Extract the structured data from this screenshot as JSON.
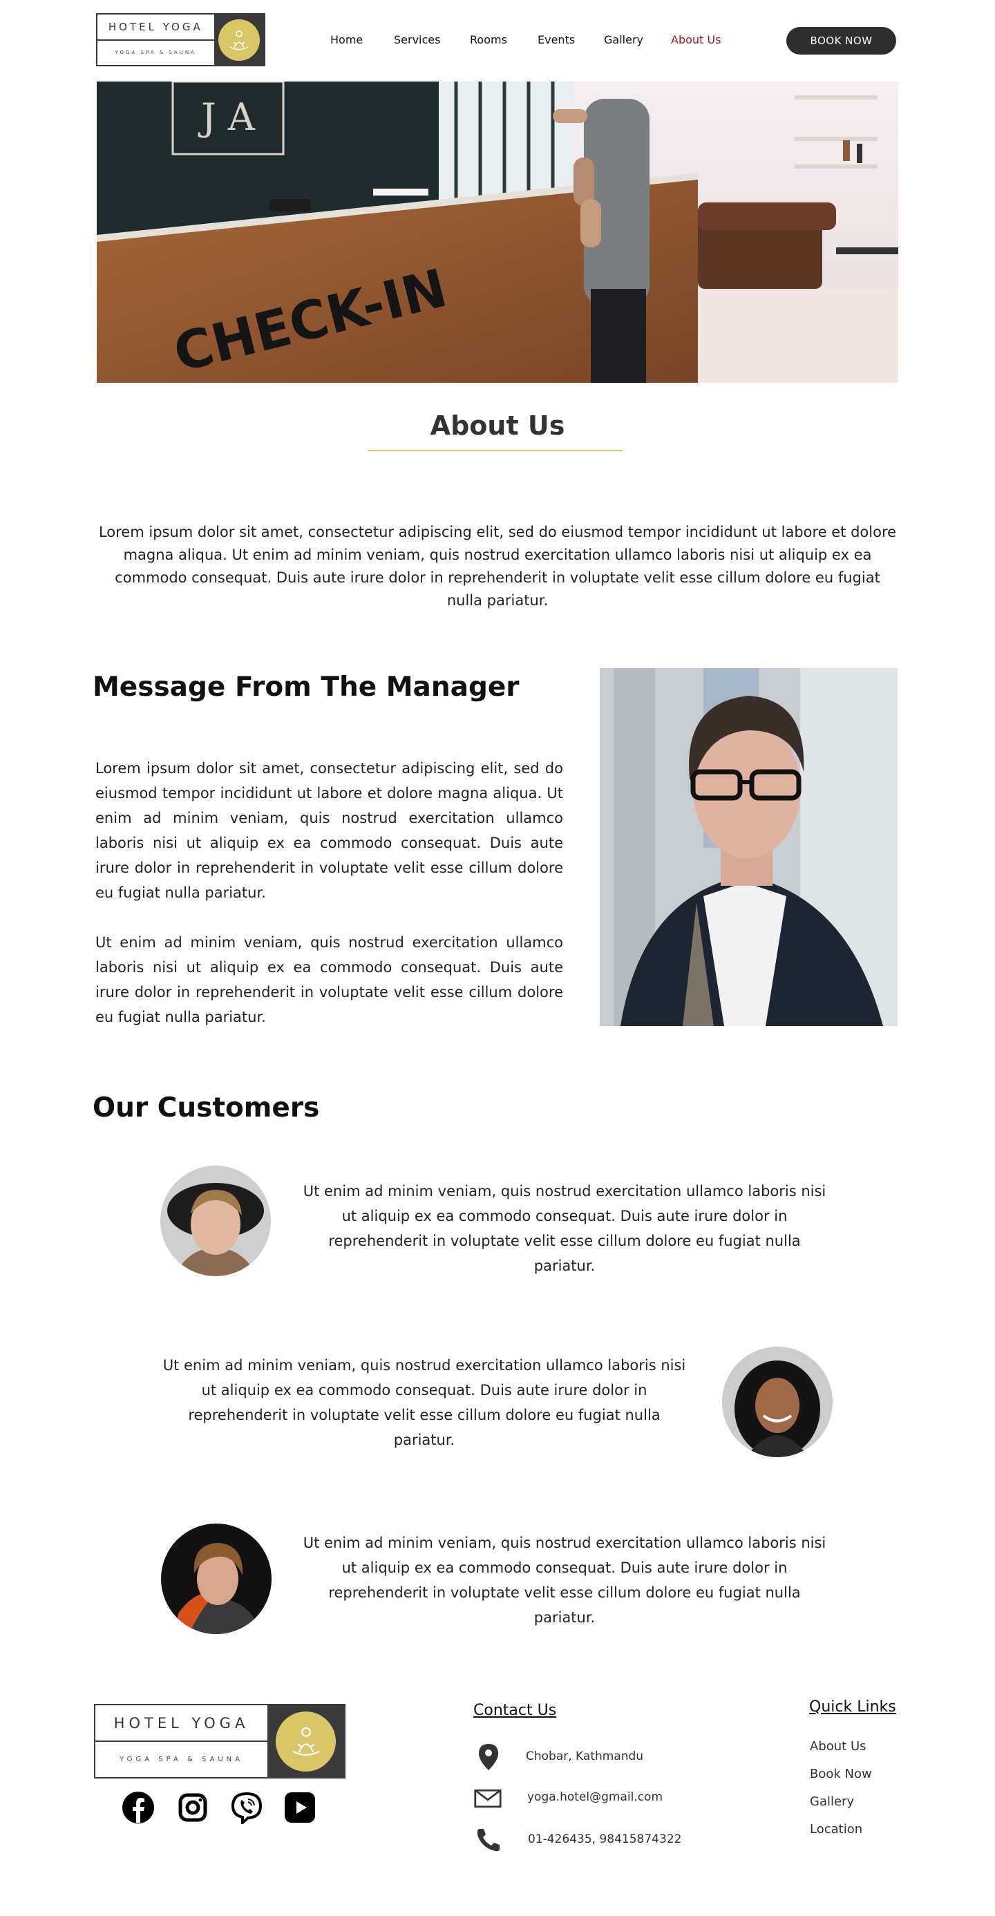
{
  "brand": {
    "name": "HOTEL YOGA",
    "tagline": "YOGA SPA & SAUNA",
    "badge_color": "#d9c667"
  },
  "nav": {
    "items": [
      {
        "label": "Home"
      },
      {
        "label": "Services"
      },
      {
        "label": "Rooms"
      },
      {
        "label": "Events"
      },
      {
        "label": "Gallery"
      },
      {
        "label": "About Us",
        "active": true
      }
    ],
    "active_color": "#a01820",
    "book_label": "BOOK NOW"
  },
  "hero": {
    "sign_letters": "J A",
    "counter_text": "CHECK-IN"
  },
  "about": {
    "title": "About Us",
    "text": "Lorem ipsum dolor sit amet, consectetur adipiscing elit, sed do eiusmod tempor incididunt ut labore et dolore magna aliqua. Ut enim ad minim veniam, quis nostrud exercitation ullamco laboris nisi ut aliquip ex ea commodo consequat. Duis aute irure dolor in reprehenderit in voluptate velit esse cillum dolore eu fugiat nulla pariatur."
  },
  "manager": {
    "title": "Message From The Manager",
    "paragraph_1": "Lorem ipsum dolor sit amet, consectetur adipiscing elit, sed do eiusmod tempor incididunt ut labore et dolore magna aliqua. Ut enim ad minim veniam, quis nostrud exercitation ullamco laboris nisi ut aliquip ex ea commodo consequat. Duis aute irure dolor in reprehenderit in voluptate velit esse cillum dolore eu fugiat nulla pariatur.",
    "paragraph_2": "Ut enim ad minim veniam, quis nostrud exercitation ullamco laboris nisi ut aliquip ex ea commodo consequat. Duis aute irure dolor in reprehenderit in voluptate velit esse cillum dolore eu fugiat nulla pariatur."
  },
  "customers": {
    "title": "Our Customers",
    "items": [
      {
        "text": "Ut enim ad minim veniam, quis nostrud exercitation ullamco laboris nisi ut aliquip ex ea commodo consequat. Duis aute irure dolor in reprehenderit in voluptate velit esse cillum dolore eu fugiat nulla pariatur."
      },
      {
        "text": "Ut enim ad minim veniam, quis nostrud exercitation ullamco laboris nisi ut aliquip ex ea commodo consequat. Duis aute irure dolor in reprehenderit in voluptate velit esse cillum dolore eu fugiat nulla pariatur."
      },
      {
        "text": "Ut enim ad minim veniam, quis nostrud exercitation ullamco laboris nisi ut aliquip ex ea commodo consequat. Duis aute irure dolor in reprehenderit in voluptate velit esse cillum dolore eu fugiat nulla pariatur."
      }
    ]
  },
  "footer": {
    "social": [
      "facebook-icon",
      "instagram-icon",
      "viber-icon",
      "youtube-icon"
    ],
    "contact": {
      "title": "Contact Us",
      "address": "Chobar, Kathmandu",
      "email": "yoga.hotel@gmail.com",
      "phone": "01-426435, 98415874322"
    },
    "quick_links": {
      "title": "Quick Links",
      "items": [
        "About Us",
        "Book Now",
        "Gallery",
        "Location"
      ]
    }
  }
}
